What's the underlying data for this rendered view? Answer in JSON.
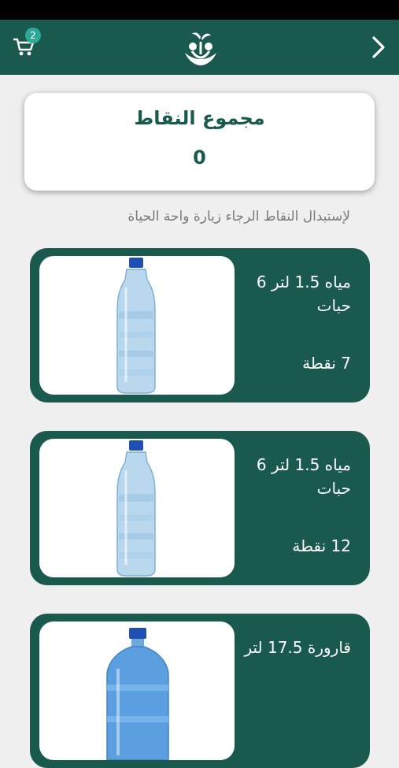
{
  "app_bar": {
    "cart_count": "2"
  },
  "points": {
    "title": "مجموع النقاط",
    "value": "0"
  },
  "note": "لإستبدال النقاط الرجاء زيارة واحة الحياة",
  "products": [
    {
      "name": "مياه 1.5 لتر 6 حبات",
      "points": "7 نقطة",
      "image": "water-bottle-icon"
    },
    {
      "name": "مياه 1.5 لتر 6 حبات",
      "points": "12 نقطة",
      "image": "water-bottle-icon"
    },
    {
      "name": "قارورة 17.5 لتر",
      "points": "",
      "image": "water-gallon-icon"
    }
  ],
  "colors": {
    "primary": "#1a5a4e",
    "badge": "#2ea898",
    "background": "#efefef"
  }
}
